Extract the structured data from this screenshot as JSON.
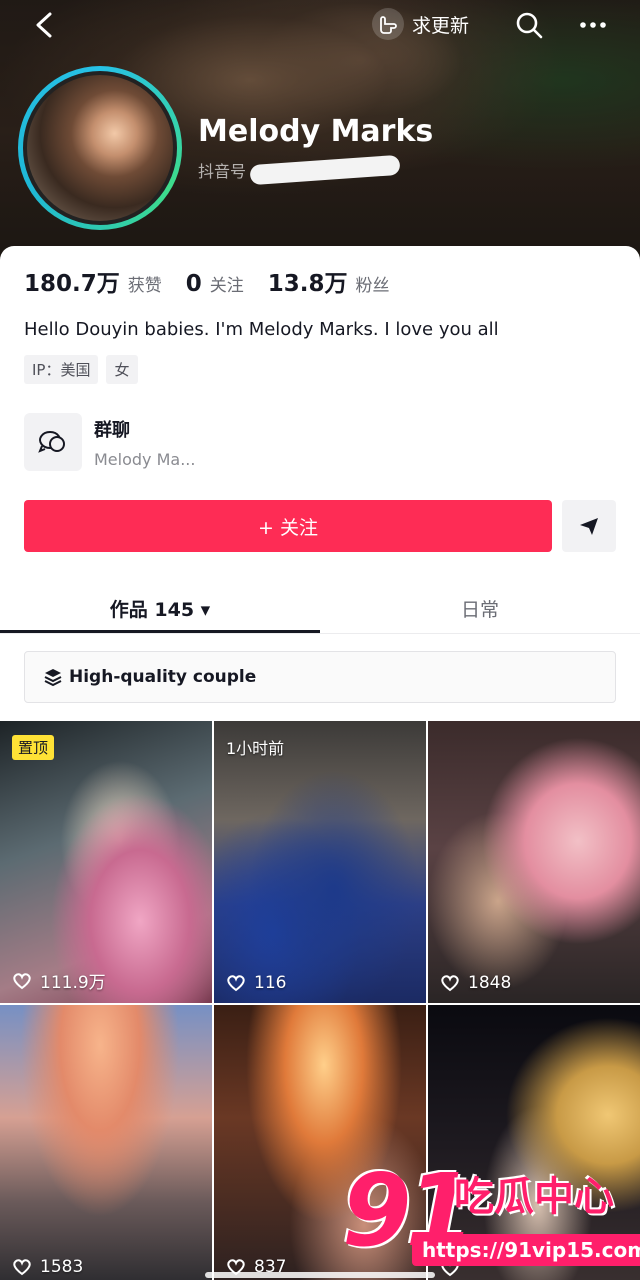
{
  "header": {
    "update_label": "求更新",
    "name": "Melody Marks",
    "id_prefix": "抖音号"
  },
  "stats": [
    {
      "value": "180.7万",
      "label": "获赞"
    },
    {
      "value": "0",
      "label": "关注"
    },
    {
      "value": "13.8万",
      "label": "粉丝"
    }
  ],
  "bio": "Hello Douyin babies. I'm Melody Marks. I love you all",
  "tags": [
    "IP：美国",
    "女"
  ],
  "group_chat": {
    "title": "群聊",
    "subtitle": "Melody Ma..."
  },
  "follow_label": "+ 关注",
  "tabs": [
    {
      "label": "作品 145 ▾",
      "active": true
    },
    {
      "label": "日常",
      "active": false
    }
  ],
  "collection_label": "High-quality couple",
  "grid": [
    {
      "badge": "置顶",
      "likes": "111.9万"
    },
    {
      "time": "1小时前",
      "likes": "116"
    },
    {
      "likes": "1848"
    },
    {
      "likes": "1583"
    },
    {
      "likes": "837"
    },
    {
      "likes": ""
    }
  ],
  "watermark": {
    "brand": "91",
    "cn": "吃瓜中心",
    "url": "https://91vip15.com"
  },
  "colors": {
    "accent": "#fe2c55",
    "pin_badge": "#ffe236",
    "avatar_ring": "#27c1e6"
  }
}
